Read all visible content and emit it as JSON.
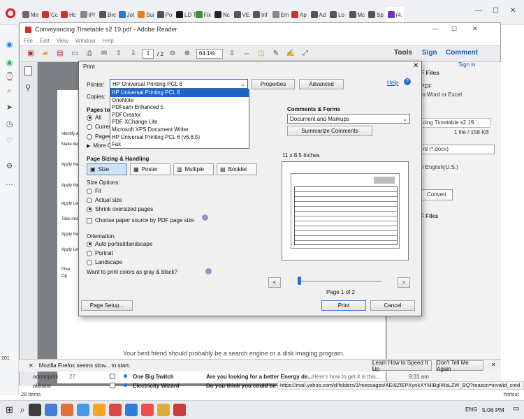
{
  "browser": {
    "tabs": [
      {
        "label": "Me",
        "color": "#6b6b6b"
      },
      {
        "label": "'Cc",
        "color": "#c7352b"
      },
      {
        "label": "Hc",
        "color": "#c7352b"
      },
      {
        "label": "IP/",
        "color": "#888"
      },
      {
        "label": "Brc",
        "color": "#555"
      },
      {
        "label": "Jot",
        "color": "#2a7ad2"
      },
      {
        "label": "Sui",
        "color": "#e87b1c"
      },
      {
        "label": "Po",
        "color": "#555"
      },
      {
        "label": "LD Ter",
        "color": "#1a1a1a"
      },
      {
        "label": "Fix",
        "color": "#3b8d3b"
      },
      {
        "label": "Nc",
        "color": "#222"
      },
      {
        "label": "VE",
        "color": "#555"
      },
      {
        "label": "Inf",
        "color": "#555"
      },
      {
        "label": "Em",
        "color": "#888"
      },
      {
        "label": "Ap",
        "color": "#c7352b"
      },
      {
        "label": "Ad",
        "color": "#555"
      },
      {
        "label": "Lo",
        "color": "#555"
      },
      {
        "label": "Mc",
        "color": "#555"
      },
      {
        "label": "Sp",
        "color": "#555"
      },
      {
        "label": "(4.",
        "color": "#6b33c8"
      }
    ],
    "window_controls": [
      "—",
      "☐",
      "✕"
    ]
  },
  "reader": {
    "title": "Conveyancing Timetable s2 19.pdf - Adobe Reader",
    "menu": [
      "File",
      "Edit",
      "View",
      "Window",
      "Help"
    ],
    "page_current": "1",
    "page_total": "/ 2",
    "zoom": "64.1%",
    "right_links": [
      "Tools",
      "Sign",
      "Comment"
    ],
    "sign_in": "Sign in",
    "right_pane": {
      "export_header": "F Files",
      "pdf_label": "PDF",
      "convert_text": "to Word or Excel",
      "file_name": "cing Timetable s2 19...",
      "file_meta": "1 file / 158 KB",
      "format": "rd (*.docx)",
      "language": "n English(U.S.)",
      "convert_button": "Convert",
      "files_header": "F Files"
    },
    "close_controls": [
      "—",
      "☐",
      "✕"
    ]
  },
  "dialog": {
    "title": "Print",
    "printer_label": "Printer:",
    "printer_value": "HP Universal Printing PCL 6",
    "properties": "Properties",
    "advanced": "Advanced",
    "help": "Help",
    "copies_label": "Copies:",
    "printer_options": [
      "HP Universal Printing PCL 6",
      "OneNote",
      "PDFsam Enhanced 5",
      "PDFCreator",
      "PDF-XChange Lite",
      "Microsoft XPS Document Writer",
      "HP Universal Printing PCL 6 (v6.6.5)",
      "Fax"
    ],
    "pages_to_print": "Pages to P",
    "pages_all": "All",
    "pages_current": "Current",
    "pages_pages": "Pages",
    "more_options": "More O",
    "comments_forms_label": "Comments & Forms",
    "comments_forms_value": "Document and Markups",
    "summarize": "Summarize Comments",
    "sizing_label": "Page Sizing & Handling",
    "tabs": [
      "Size",
      "Poster",
      "Multiple",
      "Booklet"
    ],
    "size_options_label": "Size Options:",
    "fit": "Fit",
    "actual_size": "Actual size",
    "shrink": "Shrink oversized pages",
    "choose_source": "Choose paper source by PDF page size",
    "orientation_label": "Orientation:",
    "auto": "Auto portrait/landscape",
    "portrait": "Portrait",
    "landscape": "Landscape",
    "gray": "Want to print colors as gray & black?",
    "paper_size": "11 x 8.5 Inches",
    "page_of": "Page 1 of 2",
    "page_setup": "Page Setup...",
    "print": "Print",
    "cancel": "Cancel",
    "prev": "<",
    "next": ">"
  },
  "page_snippets": [
    {
      "text": "Identify and"
    },
    {
      "text": "Make decis"
    },
    {
      "text": "Apply the l"
    },
    {
      "text": "Apply the l"
    },
    {
      "text": "Apply Lega"
    },
    {
      "text": "Take instruc"
    },
    {
      "text": "Apply the l"
    },
    {
      "text": "Apply Lega"
    },
    {
      "text": "Plea"
    },
    {
      "text": "Op"
    }
  ],
  "mail": {
    "snippet_top": "Your best friend should probably be a search engine or a disk imaging program.",
    "firefox_warning": "Mozilla Firefox seems slow... to start.",
    "learn_button": "Learn How to Speed It Up",
    "dismiss_button": "Don't Tell Me Again",
    "rows": [
      {
        "sender": "adminpolli",
        "count": "27",
        "subject_from": "One Big Switch",
        "subject": "Are you looking for a better Energy de...",
        "preview": "Here's how to get it is this...",
        "time": "9:31 am"
      },
      {
        "sender": "alibaba",
        "count": "",
        "subject_from": "Electricity Wizard",
        "subject": "Do you think you could be p...",
        "preview": "",
        "time": "10:"
      }
    ],
    "items_count": "28 items",
    "status_url": "https://mail.yahoo.com/d/folders/1/messages/AEI8ZfEPXynkXYMIBgIWoLZW_BQ?reason=invalid_cred",
    "edge_labels": [
      "201",
      "hortcut"
    ]
  },
  "taskbar": {
    "lang": "ENG",
    "time": "5:06 PM",
    "app_colors": [
      "#1f1f1f",
      "#2a6bd0",
      "#e05a1d",
      "#2a8be0",
      "#ff9500",
      "#d62b2b",
      "#0a6cd3",
      "#e33",
      "#d8a11a",
      "#c31e1e"
    ]
  }
}
